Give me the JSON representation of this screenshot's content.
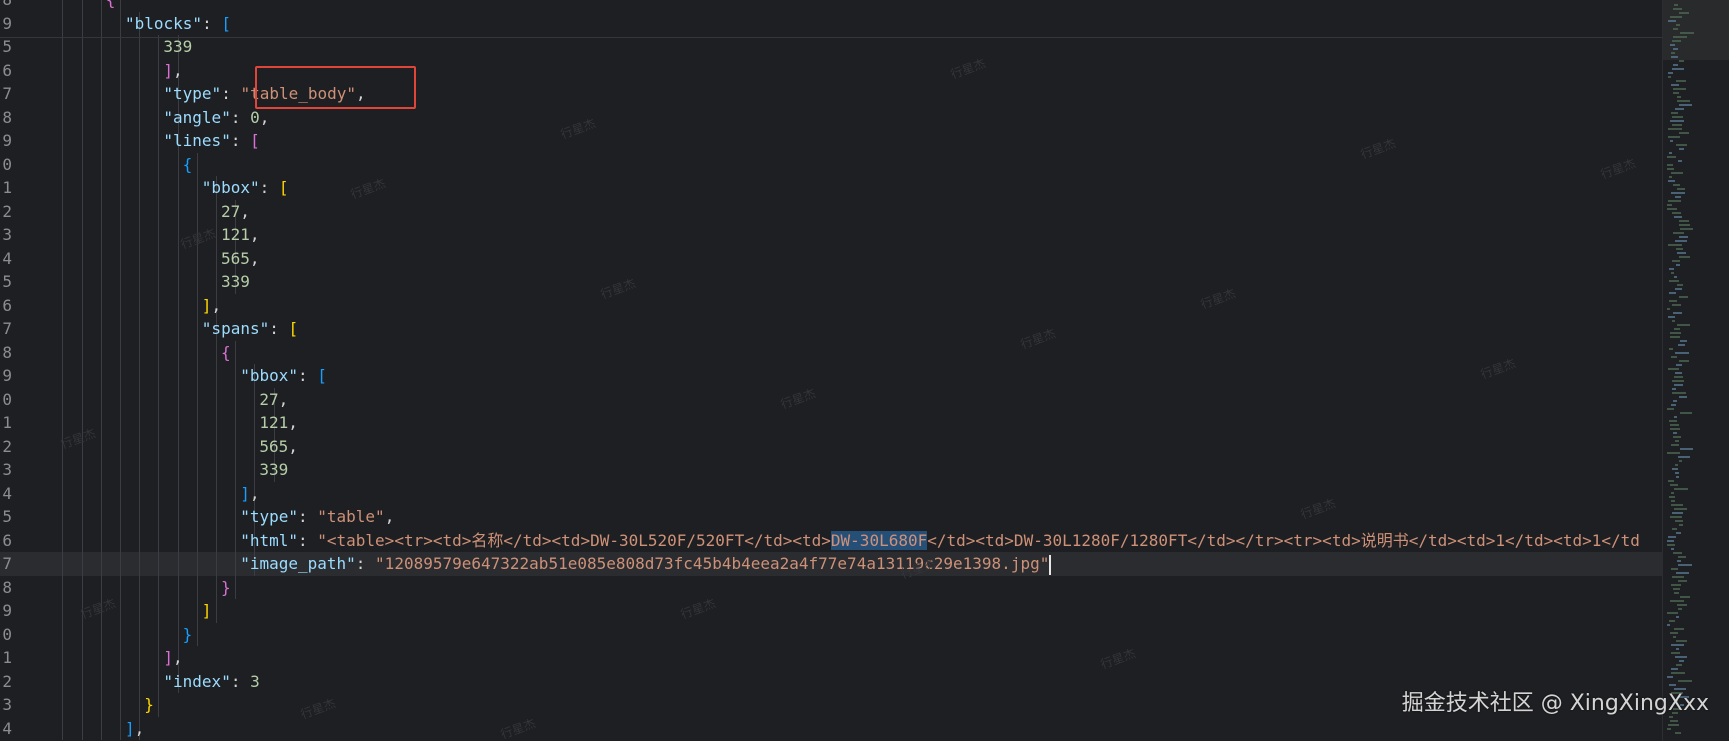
{
  "colors": {
    "background": "#1e1f22",
    "key": "#9cdcfe",
    "string": "#ce9178",
    "number": "#b5cea8",
    "highlight_box": "#e0453a",
    "selection": "#264f78"
  },
  "editor": {
    "language": "json",
    "current_line_number": "7",
    "lines": [
      {
        "num": "8",
        "indent": 6,
        "tokens": [
          {
            "t": "b2",
            "v": "{"
          }
        ]
      },
      {
        "num": "9",
        "indent": 7,
        "tokens": [
          {
            "t": "key",
            "v": "\"blocks\""
          },
          {
            "t": "pun",
            "v": ": "
          },
          {
            "t": "b3",
            "v": "["
          }
        ]
      },
      {
        "num": "5",
        "indent": 9,
        "tokens": [
          {
            "t": "num",
            "v": "339"
          }
        ]
      },
      {
        "num": "6",
        "indent": 9,
        "tokens": [
          {
            "t": "b2",
            "v": "]"
          },
          {
            "t": "pun",
            "v": ","
          }
        ]
      },
      {
        "num": "7",
        "indent": 9,
        "tokens": [
          {
            "t": "key",
            "v": "\"type\""
          },
          {
            "t": "pun",
            "v": ": "
          },
          {
            "t": "str",
            "v": "\"table_body\""
          },
          {
            "t": "pun",
            "v": ","
          }
        ]
      },
      {
        "num": "8",
        "indent": 9,
        "tokens": [
          {
            "t": "key",
            "v": "\"angle\""
          },
          {
            "t": "pun",
            "v": ": "
          },
          {
            "t": "num",
            "v": "0"
          },
          {
            "t": "pun",
            "v": ","
          }
        ]
      },
      {
        "num": "9",
        "indent": 9,
        "tokens": [
          {
            "t": "key",
            "v": "\"lines\""
          },
          {
            "t": "pun",
            "v": ": "
          },
          {
            "t": "b2",
            "v": "["
          }
        ]
      },
      {
        "num": "0",
        "indent": 10,
        "tokens": [
          {
            "t": "b3",
            "v": "{"
          }
        ]
      },
      {
        "num": "1",
        "indent": 11,
        "tokens": [
          {
            "t": "key",
            "v": "\"bbox\""
          },
          {
            "t": "pun",
            "v": ": "
          },
          {
            "t": "b1",
            "v": "["
          }
        ]
      },
      {
        "num": "2",
        "indent": 12,
        "tokens": [
          {
            "t": "num",
            "v": "27"
          },
          {
            "t": "pun",
            "v": ","
          }
        ]
      },
      {
        "num": "3",
        "indent": 12,
        "tokens": [
          {
            "t": "num",
            "v": "121"
          },
          {
            "t": "pun",
            "v": ","
          }
        ]
      },
      {
        "num": "4",
        "indent": 12,
        "tokens": [
          {
            "t": "num",
            "v": "565"
          },
          {
            "t": "pun",
            "v": ","
          }
        ]
      },
      {
        "num": "5",
        "indent": 12,
        "tokens": [
          {
            "t": "num",
            "v": "339"
          }
        ]
      },
      {
        "num": "6",
        "indent": 11,
        "tokens": [
          {
            "t": "b1",
            "v": "]"
          },
          {
            "t": "pun",
            "v": ","
          }
        ]
      },
      {
        "num": "7",
        "indent": 11,
        "tokens": [
          {
            "t": "key",
            "v": "\"spans\""
          },
          {
            "t": "pun",
            "v": ": "
          },
          {
            "t": "b1",
            "v": "["
          }
        ]
      },
      {
        "num": "8",
        "indent": 12,
        "tokens": [
          {
            "t": "b2",
            "v": "{"
          }
        ]
      },
      {
        "num": "9",
        "indent": 13,
        "tokens": [
          {
            "t": "key",
            "v": "\"bbox\""
          },
          {
            "t": "pun",
            "v": ": "
          },
          {
            "t": "b3",
            "v": "["
          }
        ]
      },
      {
        "num": "0",
        "indent": 14,
        "tokens": [
          {
            "t": "num",
            "v": "27"
          },
          {
            "t": "pun",
            "v": ","
          }
        ]
      },
      {
        "num": "1",
        "indent": 14,
        "tokens": [
          {
            "t": "num",
            "v": "121"
          },
          {
            "t": "pun",
            "v": ","
          }
        ]
      },
      {
        "num": "2",
        "indent": 14,
        "tokens": [
          {
            "t": "num",
            "v": "565"
          },
          {
            "t": "pun",
            "v": ","
          }
        ]
      },
      {
        "num": "3",
        "indent": 14,
        "tokens": [
          {
            "t": "num",
            "v": "339"
          }
        ]
      },
      {
        "num": "4",
        "indent": 13,
        "tokens": [
          {
            "t": "b3",
            "v": "]"
          },
          {
            "t": "pun",
            "v": ","
          }
        ]
      },
      {
        "num": "5",
        "indent": 13,
        "tokens": [
          {
            "t": "key",
            "v": "\"type\""
          },
          {
            "t": "pun",
            "v": ": "
          },
          {
            "t": "str",
            "v": "\"table\""
          },
          {
            "t": "pun",
            "v": ","
          }
        ]
      },
      {
        "num": "6",
        "indent": 13,
        "tokens": [
          {
            "t": "key",
            "v": "\"html\""
          },
          {
            "t": "pun",
            "v": ": "
          },
          {
            "t": "str",
            "v": "\"<table><tr><td>名称</td><td>DW-30L520F/520FT</td><td>"
          },
          {
            "t": "str hl",
            "v": "DW-30L680F"
          },
          {
            "t": "str",
            "v": "</td><td>DW-30L1280F/1280FT</td></tr><tr><td>说明书</td><td>1</td><td>1</td"
          }
        ]
      },
      {
        "num": "7",
        "indent": 13,
        "current": true,
        "tokens": [
          {
            "t": "key",
            "v": "\"image_path\""
          },
          {
            "t": "pun",
            "v": ": "
          },
          {
            "t": "str",
            "v": "\"12089579e647322ab51e085e808d73fc45b4b4eea2a4f77e74a13119c29e1398.jpg\""
          },
          {
            "t": "cursor",
            "v": ""
          }
        ]
      },
      {
        "num": "8",
        "indent": 12,
        "tokens": [
          {
            "t": "b2",
            "v": "}"
          }
        ]
      },
      {
        "num": "9",
        "indent": 11,
        "tokens": [
          {
            "t": "b1",
            "v": "]"
          }
        ]
      },
      {
        "num": "0",
        "indent": 10,
        "tokens": [
          {
            "t": "b3",
            "v": "}"
          }
        ]
      },
      {
        "num": "1",
        "indent": 9,
        "tokens": [
          {
            "t": "b2",
            "v": "]"
          },
          {
            "t": "pun",
            "v": ","
          }
        ]
      },
      {
        "num": "2",
        "indent": 9,
        "tokens": [
          {
            "t": "key",
            "v": "\"index\""
          },
          {
            "t": "pun",
            "v": ": "
          },
          {
            "t": "num",
            "v": "3"
          }
        ]
      },
      {
        "num": "3",
        "indent": 8,
        "tokens": [
          {
            "t": "b1",
            "v": "}"
          }
        ]
      },
      {
        "num": "4",
        "indent": 7,
        "tokens": [
          {
            "t": "b3",
            "v": "]"
          },
          {
            "t": "pun",
            "v": ","
          }
        ]
      }
    ]
  },
  "watermark": {
    "text": "掘金技术社区 @ XingXingXxx",
    "faint_text": "行星杰"
  }
}
